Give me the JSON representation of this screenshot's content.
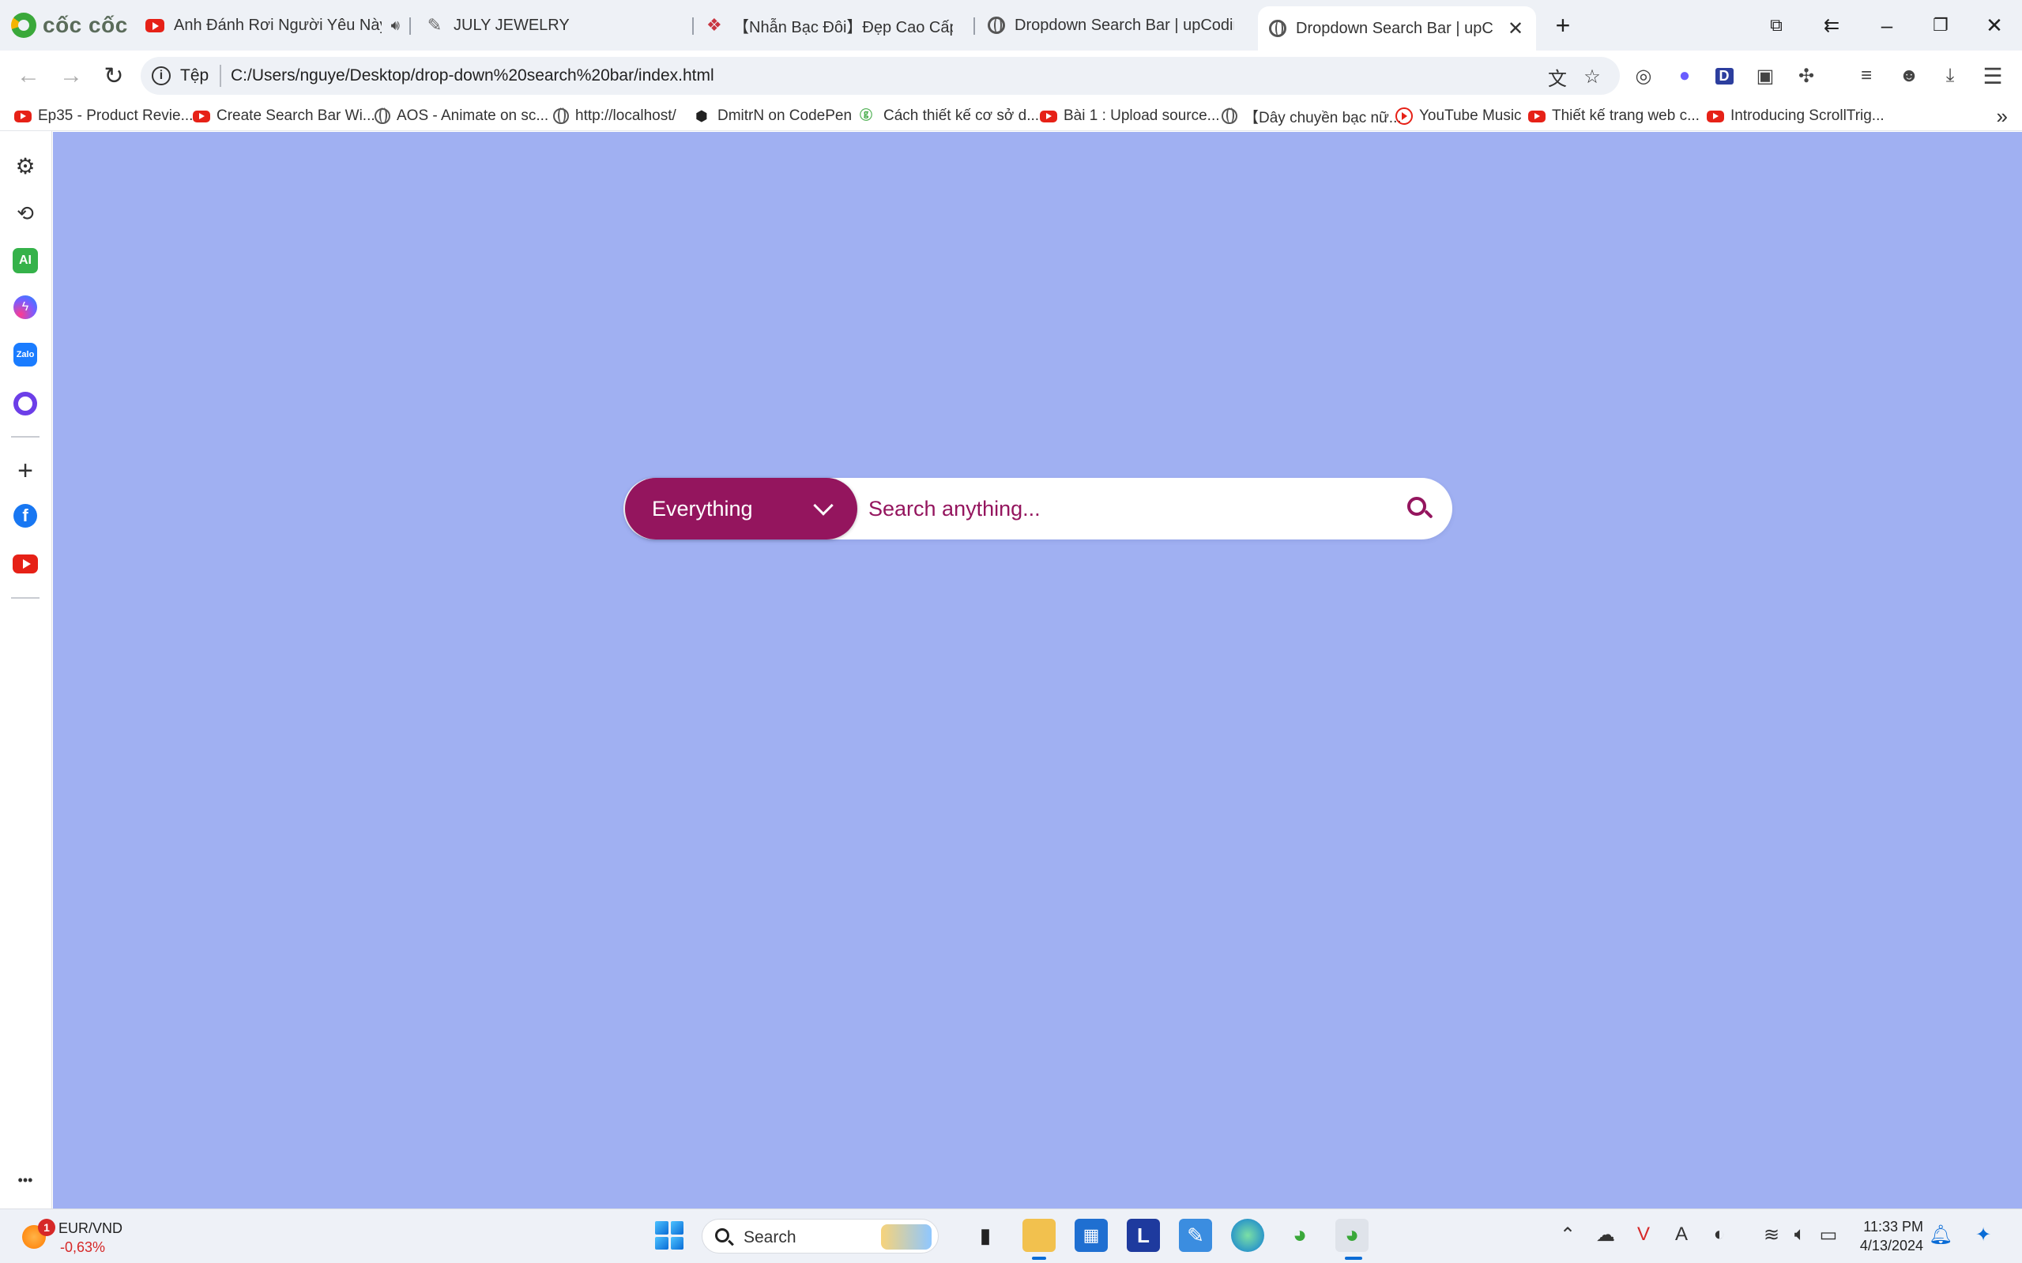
{
  "browser": {
    "brand": "cốc cốc",
    "tabs": [
      {
        "title": "Anh Đánh Rơi Người Yêu Này,",
        "favicon": "youtube-icon",
        "audio": true
      },
      {
        "title": "JULY JEWELRY",
        "favicon": "brush-icon"
      },
      {
        "title": "【Nhẫn Bạc Đôi】Đẹp Cao Cấp Mới",
        "favicon": "jewel-icon"
      },
      {
        "title": "Dropdown Search Bar | upCoding",
        "favicon": "globe-icon"
      },
      {
        "title": "Dropdown Search Bar | upCo",
        "favicon": "globe-icon",
        "active": true
      }
    ],
    "new_tab": "+",
    "address": {
      "scheme_label": "Tệp",
      "url": "C:/Users/nguye/Desktop/drop-down%20search%20bar/index.html"
    },
    "bookmarks": [
      {
        "label": "Ep35 - Product Revie...",
        "icon": "youtube-icon"
      },
      {
        "label": "Create Search Bar Wi...",
        "icon": "youtube-icon"
      },
      {
        "label": "AOS - Animate on sc...",
        "icon": "globe-icon"
      },
      {
        "label": "http://localhost/",
        "icon": "globe-icon"
      },
      {
        "label": "DmitrN on CodePen",
        "icon": "codepen-icon"
      },
      {
        "label": "Cách thiết kế cơ sở d...",
        "icon": "gg-icon"
      },
      {
        "label": "Bài 1 : Upload source...",
        "icon": "youtube-icon"
      },
      {
        "label": "【Dây chuyền bạc nữ...",
        "icon": "globe-icon"
      },
      {
        "label": "YouTube Music",
        "icon": "youtube-music-icon"
      },
      {
        "label": "Thiết kế trang web c...",
        "icon": "youtube-icon"
      },
      {
        "label": "Introducing ScrollTrig...",
        "icon": "youtube-icon"
      }
    ],
    "sidebar": {
      "ai_label": "AI",
      "zalo_label": "Zalo",
      "facebook_label": "f",
      "more_label": "•••"
    }
  },
  "page": {
    "background": "#a0b0f2",
    "accent": "#94155e",
    "dropdown": {
      "selected": "Everything"
    },
    "search": {
      "placeholder": "Search anything..."
    }
  },
  "taskbar": {
    "widget": {
      "badge": "1",
      "pair": "EUR/VND",
      "change": "-0,63%"
    },
    "search_label": "Search",
    "clock": {
      "time": "11:33 PM",
      "date": "4/13/2024"
    }
  }
}
